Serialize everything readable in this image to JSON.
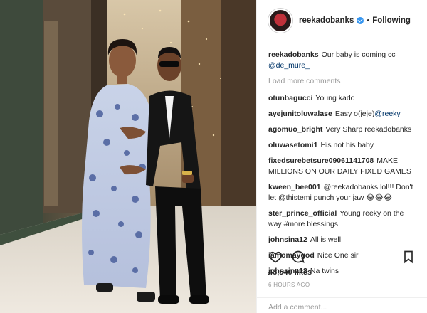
{
  "header": {
    "username": "reekadobanks",
    "separator": "•",
    "follow_status": "Following"
  },
  "caption": {
    "username": "reekadobanks",
    "text": "Our baby is coming cc ",
    "mention": "@de_mure_"
  },
  "load_more": "Load more comments",
  "comments": [
    {
      "user": "otunbagucci",
      "text": "Young kado"
    },
    {
      "user": "ayejunitoluwalase",
      "text": "Easy o(jeje)",
      "mention": "@reeky"
    },
    {
      "user": "agomuo_bright",
      "text": "Very Sharp reekadobanks"
    },
    {
      "user": "oluwasetomi1",
      "text": "His not his baby"
    },
    {
      "user": "fixedsurebetsure09061141708",
      "text": "MAKE MILLIONS ON OUR DAILY FIXED GAMES"
    },
    {
      "user": "kween_bee001",
      "text": "@reekadobanks lol!!! Don't let @thistemi punch your jaw 😂😂😂"
    },
    {
      "user": "ster_prince_official",
      "text": "Young reeky on the way #more blessings"
    },
    {
      "user": "johnsina12",
      "text": "All is well"
    },
    {
      "user": "iamomaygod",
      "text": "Nice One sir"
    },
    {
      "user": "johnsina12",
      "text": "Na twins"
    }
  ],
  "likes": "43,540 likes",
  "timestamp": "6 hours ago",
  "add_comment_placeholder": "Add a comment...",
  "icons": {
    "like": "heart-icon",
    "comment": "comment-icon",
    "save": "bookmark-icon",
    "verified": "verified-badge-icon"
  },
  "colors": {
    "verified": "#3897f0",
    "mention": "#003569",
    "muted": "#999999",
    "text": "#262626"
  }
}
